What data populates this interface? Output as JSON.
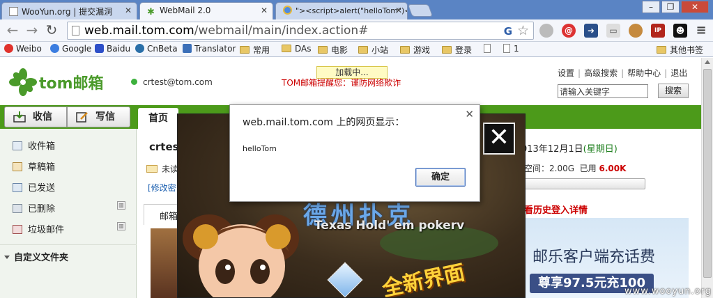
{
  "browser": {
    "tabs": [
      {
        "title": "WooYun.org | 提交漏洞",
        "active": false
      },
      {
        "title": "WebMail 2.0",
        "active": true
      },
      {
        "title": "\"><script>alert(\"helloTom\")<",
        "active": false
      }
    ],
    "url_host": "web.mail.tom.com",
    "url_path": "/webmail/main/index.action#",
    "bookmarks": [
      "Weibo",
      "Google",
      "Baidu",
      "CnBeta",
      "Translator",
      "常用",
      "DAs",
      "电影",
      "小站",
      "游戏",
      "登录",
      "",
      "1"
    ],
    "other_bookmarks": "其他书签"
  },
  "header": {
    "logo_text": "tom邮箱",
    "user_email": "crtest@tom.com",
    "loading": "加载中...",
    "warning": "TOM邮箱提醒您：谨防网络欺诈",
    "links": [
      "设置",
      "高级搜索",
      "帮助中心",
      "退出"
    ],
    "search_placeholder": "请输入关键字",
    "search_button": "搜索"
  },
  "toolbar": {
    "receive": "收信",
    "write": "写信",
    "home_tab": "首页"
  },
  "sidebar": {
    "items": [
      {
        "label": "收件箱",
        "icon": "inbox-icon"
      },
      {
        "label": "草稿箱",
        "icon": "drafts-icon"
      },
      {
        "label": "已发送",
        "icon": "sent-icon"
      },
      {
        "label": "已删除",
        "icon": "deleted-icon"
      },
      {
        "label": "垃圾邮件",
        "icon": "spam-icon"
      }
    ],
    "custom_folders": "自定义文件夹"
  },
  "main": {
    "username": "crtest",
    "unread": "未读",
    "change_password": "[修改密",
    "mail_tab": "邮箱",
    "date": "013年12月1日",
    "weekday": "(星期日)",
    "quota_label": "空间：2.00G",
    "used_label": "已用",
    "used_value": "6.00K",
    "history": "看历史登入详情",
    "ad_line1": "邮乐客户端充话费",
    "ad_line2": "尊享97.5元充100"
  },
  "game_ad": {
    "subtitle": "Texas Hold' em pokerv",
    "slogan": "全新界面"
  },
  "dialog": {
    "title": "web.mail.tom.com 上的网页显示：",
    "message": "helloTom",
    "ok": "确定"
  },
  "watermark": "www.wooyun.org"
}
